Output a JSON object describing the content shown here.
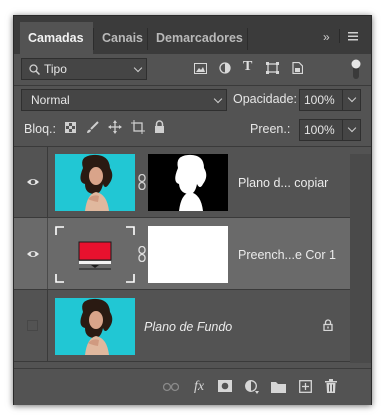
{
  "tabs": [
    "Camadas",
    "Canais",
    "Demarcadores"
  ],
  "filter": {
    "value": "Tipo"
  },
  "blend": {
    "mode": "Normal",
    "opacity_label": "Opacidade:",
    "opacity_value": "100%"
  },
  "lock": {
    "label": "Bloq.:",
    "fill_label": "Preen.:",
    "fill_value": "100%"
  },
  "layers": [
    {
      "name": "Plano d... copiar",
      "visible": true,
      "selected": false,
      "italic": false
    },
    {
      "name": "Preench...e Cor 1",
      "visible": true,
      "selected": true,
      "italic": false
    },
    {
      "name": "Plano de Fundo",
      "visible": false,
      "selected": false,
      "italic": true,
      "locked": true
    }
  ],
  "fill_color": "#e8112e",
  "photo_bg_color": "#21c7d4",
  "footer_fx_label": "fx"
}
